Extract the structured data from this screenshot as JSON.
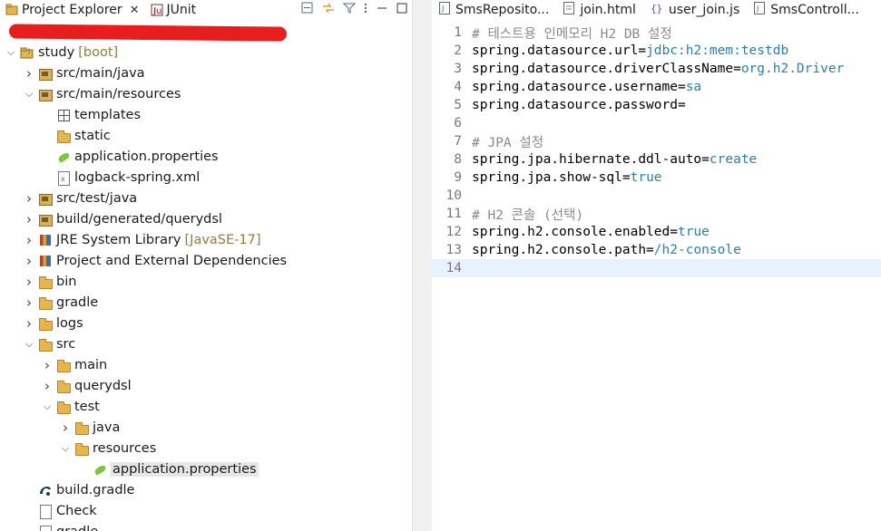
{
  "explorer": {
    "tabs": [
      {
        "label": "Project Explorer",
        "close": "✕"
      },
      {
        "label": "JUnit"
      }
    ],
    "tree": [
      {
        "indent": 0,
        "arrow": "expanded",
        "icon": "project-icon",
        "label": "study",
        "decor": "[boot]"
      },
      {
        "indent": 1,
        "arrow": "collapsed",
        "icon": "package-folder-icon",
        "label": "src/main/java"
      },
      {
        "indent": 1,
        "arrow": "expanded",
        "icon": "package-folder-icon",
        "label": "src/main/resources"
      },
      {
        "indent": 2,
        "arrow": "none",
        "icon": "templates-folder-icon",
        "label": "templates"
      },
      {
        "indent": 2,
        "arrow": "none",
        "icon": "folder-icon",
        "label": "static"
      },
      {
        "indent": 2,
        "arrow": "none",
        "icon": "properties-file-icon",
        "label": "application.properties"
      },
      {
        "indent": 2,
        "arrow": "none",
        "icon": "xml-file-icon",
        "label": "logback-spring.xml"
      },
      {
        "indent": 1,
        "arrow": "collapsed",
        "icon": "package-folder-icon",
        "label": "src/test/java"
      },
      {
        "indent": 1,
        "arrow": "collapsed",
        "icon": "package-folder-icon",
        "label": "build/generated/querydsl"
      },
      {
        "indent": 1,
        "arrow": "collapsed",
        "icon": "library-icon",
        "label": "JRE System Library",
        "decor": "[JavaSE-17]"
      },
      {
        "indent": 1,
        "arrow": "collapsed",
        "icon": "library-icon",
        "label": "Project and External Dependencies"
      },
      {
        "indent": 1,
        "arrow": "collapsed",
        "icon": "folder-icon",
        "label": "bin"
      },
      {
        "indent": 1,
        "arrow": "collapsed",
        "icon": "folder-icon",
        "label": "gradle"
      },
      {
        "indent": 1,
        "arrow": "collapsed",
        "icon": "folder-icon",
        "label": "logs"
      },
      {
        "indent": 1,
        "arrow": "expanded",
        "icon": "folder-icon",
        "label": "src"
      },
      {
        "indent": 2,
        "arrow": "collapsed",
        "icon": "folder-icon",
        "label": "main"
      },
      {
        "indent": 2,
        "arrow": "collapsed",
        "icon": "folder-icon",
        "label": "querydsl"
      },
      {
        "indent": 2,
        "arrow": "expanded",
        "icon": "folder-icon",
        "label": "test"
      },
      {
        "indent": 3,
        "arrow": "collapsed",
        "icon": "folder-icon",
        "label": "java"
      },
      {
        "indent": 3,
        "arrow": "expanded",
        "icon": "folder-icon",
        "label": "resources"
      },
      {
        "indent": 4,
        "arrow": "none",
        "icon": "properties-file-icon",
        "label": "application.properties",
        "selected": true
      },
      {
        "indent": 1,
        "arrow": "none",
        "icon": "gradle-file-icon",
        "label": "build.gradle"
      },
      {
        "indent": 1,
        "arrow": "none",
        "icon": "doc-file-icon",
        "label": "Check"
      },
      {
        "indent": 1,
        "arrow": "none",
        "icon": "doc-file-icon",
        "label": "gradle"
      }
    ]
  },
  "editor": {
    "tabs": [
      {
        "label": "SmsReposito...",
        "icon": "java-file-icon"
      },
      {
        "label": "join.html",
        "icon": "html-file-icon"
      },
      {
        "label": "user_join.js",
        "icon": "js-file-icon"
      },
      {
        "label": "SmsControll...",
        "icon": "java-file-icon"
      }
    ],
    "lines": [
      {
        "n": "1",
        "parts": [
          {
            "t": "# 테스트용 인메모리 H2 DB 설정",
            "s": "c"
          }
        ]
      },
      {
        "n": "2",
        "parts": [
          {
            "t": "spring.datasource.url=",
            "s": "k"
          },
          {
            "t": "jdbc:h2:mem:testdb",
            "s": "v"
          }
        ]
      },
      {
        "n": "3",
        "parts": [
          {
            "t": "spring.datasource.driverClassName=",
            "s": "k"
          },
          {
            "t": "org.h2.Driver",
            "s": "v"
          }
        ]
      },
      {
        "n": "4",
        "parts": [
          {
            "t": "spring.datasource.username=",
            "s": "k"
          },
          {
            "t": "sa",
            "s": "v"
          }
        ]
      },
      {
        "n": "5",
        "parts": [
          {
            "t": "spring.datasource.password=",
            "s": "k"
          }
        ]
      },
      {
        "n": "6",
        "parts": []
      },
      {
        "n": "7",
        "parts": [
          {
            "t": "# JPA 설정",
            "s": "c"
          }
        ]
      },
      {
        "n": "8",
        "parts": [
          {
            "t": "spring.jpa.hibernate.ddl-auto=",
            "s": "k"
          },
          {
            "t": "create",
            "s": "v"
          }
        ]
      },
      {
        "n": "9",
        "parts": [
          {
            "t": "spring.jpa.show-sql=",
            "s": "k"
          },
          {
            "t": "true",
            "s": "v"
          }
        ]
      },
      {
        "n": "10",
        "parts": []
      },
      {
        "n": "11",
        "parts": [
          {
            "t": "# H2 콘솔 (선택)",
            "s": "c"
          }
        ]
      },
      {
        "n": "12",
        "parts": [
          {
            "t": "spring.h2.console.enabled=",
            "s": "k"
          },
          {
            "t": "true",
            "s": "v"
          }
        ]
      },
      {
        "n": "13",
        "parts": [
          {
            "t": "spring.h2.console.path=",
            "s": "k"
          },
          {
            "t": "/h2-console",
            "s": "v"
          }
        ]
      },
      {
        "n": "14",
        "parts": [],
        "current": true
      }
    ]
  }
}
